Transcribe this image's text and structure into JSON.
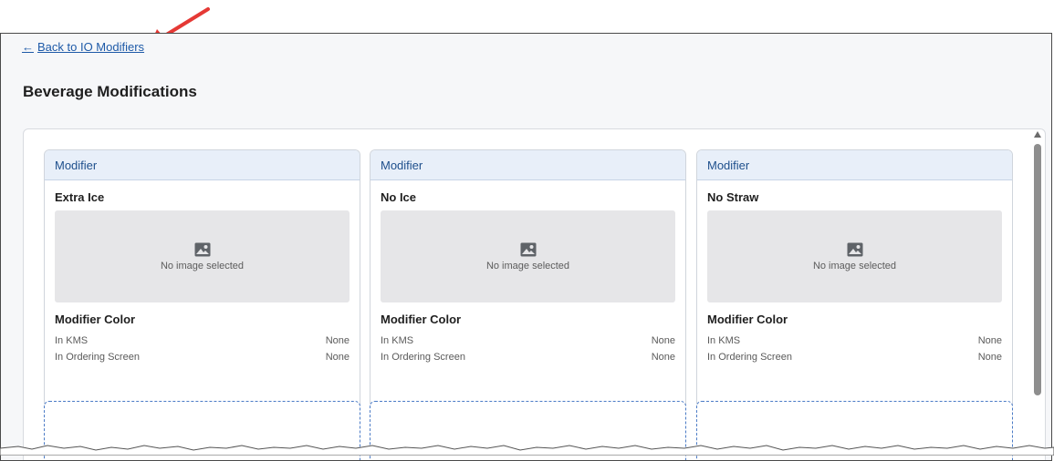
{
  "nav": {
    "back_label": "Back to IO Modifiers"
  },
  "page": {
    "title": "Beverage Modifications"
  },
  "cards": [
    {
      "header": "Modifier",
      "name": "Extra Ice",
      "no_image": "No image selected",
      "color_title": "Modifier Color",
      "kms_label": "In KMS",
      "kms_value": "None",
      "ordering_label": "In Ordering Screen",
      "ordering_value": "None"
    },
    {
      "header": "Modifier",
      "name": "No Ice",
      "no_image": "No image selected",
      "color_title": "Modifier Color",
      "kms_label": "In KMS",
      "kms_value": "None",
      "ordering_label": "In Ordering Screen",
      "ordering_value": "None"
    },
    {
      "header": "Modifier",
      "name": "No Straw",
      "no_image": "No image selected",
      "color_title": "Modifier Color",
      "kms_label": "In KMS",
      "kms_value": "None",
      "ordering_label": "In Ordering Screen",
      "ordering_value": "None"
    }
  ],
  "icons": {
    "back": "arrow-left-icon",
    "placeholder": "image-icon",
    "annotation": "red-pointer-arrow",
    "scroll": "chevron-up-icon"
  },
  "colors": {
    "link": "#1e5aa8",
    "card_header_bg": "#e8eff9",
    "card_header_text": "#1e4f8c",
    "annotation_arrow": "#e53935",
    "dashed_border": "#4b7bc6"
  }
}
